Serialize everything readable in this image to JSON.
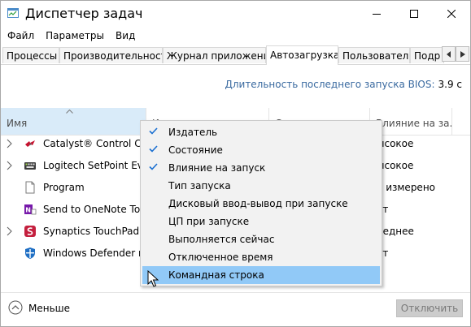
{
  "window": {
    "title": "Диспетчер задач"
  },
  "menu": [
    "Файл",
    "Параметры",
    "Вид"
  ],
  "tabs": [
    {
      "label": "Процессы"
    },
    {
      "label": "Производительность"
    },
    {
      "label": "Журнал приложений"
    },
    {
      "label": "Автозагрузка",
      "active": true
    },
    {
      "label": "Пользователи"
    },
    {
      "label": "Подр"
    }
  ],
  "bios": {
    "label": "Длительность последнего запуска BIOS:",
    "value": "3.9 с"
  },
  "columns": {
    "name": "Имя",
    "publisher": "И",
    "status": "С",
    "impact": "Влияние на за..."
  },
  "rows": [
    {
      "name": "Catalyst® Control C...",
      "impact": "ысокое",
      "icon": "amd-icon",
      "expandable": true
    },
    {
      "name": "Logitech SetPoint Ev...",
      "impact": "ысокое",
      "icon": "keyboard-icon",
      "expandable": true
    },
    {
      "name": "Program",
      "impact": "е измерено",
      "icon": "blank-file-icon",
      "expandable": false
    },
    {
      "name": "Send to OneNote Tool",
      "impact": "ет",
      "icon": "onenote-icon",
      "expandable": false
    },
    {
      "name": "Synaptics TouchPad ...",
      "impact": "реднее",
      "icon": "synaptics-icon",
      "expandable": true
    },
    {
      "name": "Windows Defender n...",
      "impact": "ет",
      "icon": "defender-icon",
      "expandable": false
    }
  ],
  "context_menu": [
    {
      "label": "Издатель",
      "checked": true
    },
    {
      "label": "Состояние",
      "checked": true
    },
    {
      "label": "Влияние на запуск",
      "checked": true
    },
    {
      "label": "Тип запуска",
      "checked": false
    },
    {
      "label": "Дисковый ввод-вывод при запуске",
      "checked": false
    },
    {
      "label": "ЦП при запуске",
      "checked": false
    },
    {
      "label": "Выполняется сейчас",
      "checked": false
    },
    {
      "label": "Отключенное время",
      "checked": false
    },
    {
      "label": "Командная строка",
      "checked": false,
      "highlighted": true
    }
  ],
  "footer": {
    "less_label": "Меньше",
    "disable_label": "Отключить"
  },
  "colors": {
    "accent": "#0078d7",
    "highlight": "#91c9f7",
    "sorted_header": "#d9ebf9",
    "bios_label": "#3a6aa0"
  }
}
